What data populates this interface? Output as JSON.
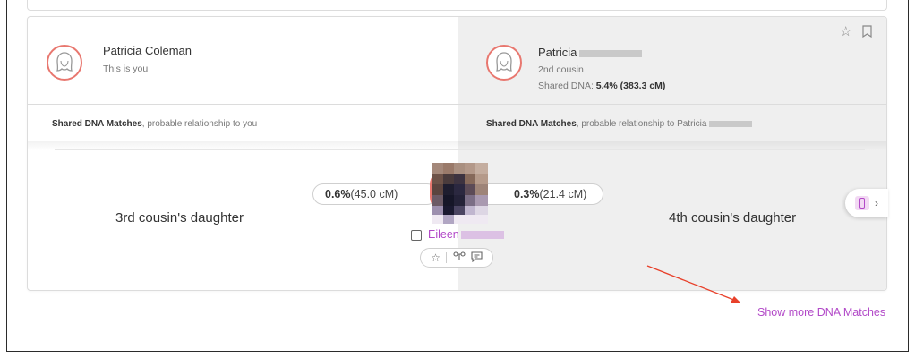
{
  "me": {
    "name": "Patricia Coleman",
    "subtitle": "This is you"
  },
  "match": {
    "name": "Patricia",
    "relationship": "2nd cousin",
    "shared_dna_label": "Shared DNA:",
    "shared_dna_value": "5.4% (383.3 cM)"
  },
  "sections": {
    "left_bold": "Shared DNA Matches",
    "left_rest": ", probable relationship to you",
    "right_bold": "Shared DNA Matches",
    "right_rest": ", probable relationship to Patricia"
  },
  "shared_match": {
    "name": "Eileen",
    "left_relationship": "3rd cousin's daughter",
    "right_relationship": "4th cousin's daughter",
    "left_pct": "0.6%",
    "left_cm": " (45.0 cM)",
    "right_pct": "0.3%",
    "right_cm": " (21.4 cM)"
  },
  "icons": {
    "star": "☆",
    "bookmark": "⊓",
    "tree": "⚲",
    "comment": "▭",
    "chevron": "›"
  },
  "colors": {
    "accent": "#b249c8",
    "avatar_ring": "#e8776f",
    "arrow": "#e8402a"
  },
  "footer": {
    "show_more": "Show more DNA Matches"
  }
}
